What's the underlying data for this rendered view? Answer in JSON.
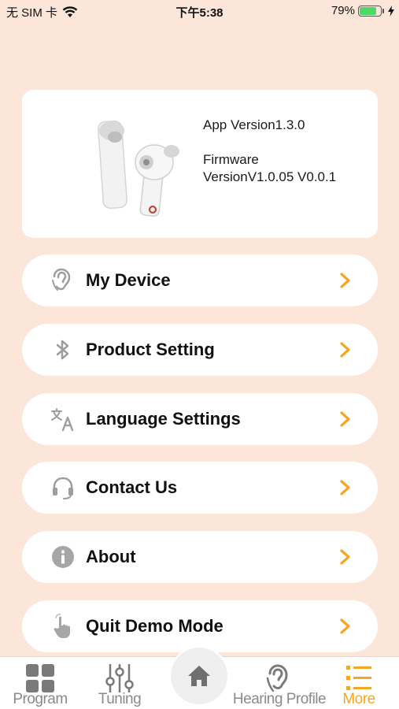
{
  "status_bar": {
    "carrier": "无 SIM 卡",
    "time": "下午5:38",
    "battery_percent_label": "79%",
    "battery_level": 0.79,
    "icons": [
      "wifi-icon",
      "battery-icon",
      "charging-icon"
    ]
  },
  "device_card": {
    "app_version": "App Version1.3.0",
    "firmware_line1": "Firmware",
    "firmware_line2": "VersionV1.0.05 V0.0.1",
    "image": "earbuds-image"
  },
  "menu": {
    "items": [
      {
        "label": "My Device",
        "icon": "ear-icon"
      },
      {
        "label": "Product Setting",
        "icon": "bluetooth-icon"
      },
      {
        "label": "Language Settings",
        "icon": "translate-icon"
      },
      {
        "label": "Contact Us",
        "icon": "headset-icon"
      },
      {
        "label": "About",
        "icon": "info-icon"
      },
      {
        "label": "Quit Demo Mode",
        "icon": "hand-pointer-icon"
      }
    ],
    "chevron_icon": "chevron-right-icon"
  },
  "tab_bar": {
    "tabs": [
      {
        "label": "Program",
        "icon": "grid-icon"
      },
      {
        "label": "Tuning",
        "icon": "sliders-icon"
      },
      {
        "label": "",
        "icon": "home-icon"
      },
      {
        "label": "Hearing Profile",
        "icon": "hearing-icon"
      },
      {
        "label": "More",
        "icon": "list-icon",
        "active": true
      }
    ]
  },
  "colors": {
    "background": "#fce6da",
    "accent": "#f5a623",
    "inactive": "#8a8a8a"
  }
}
